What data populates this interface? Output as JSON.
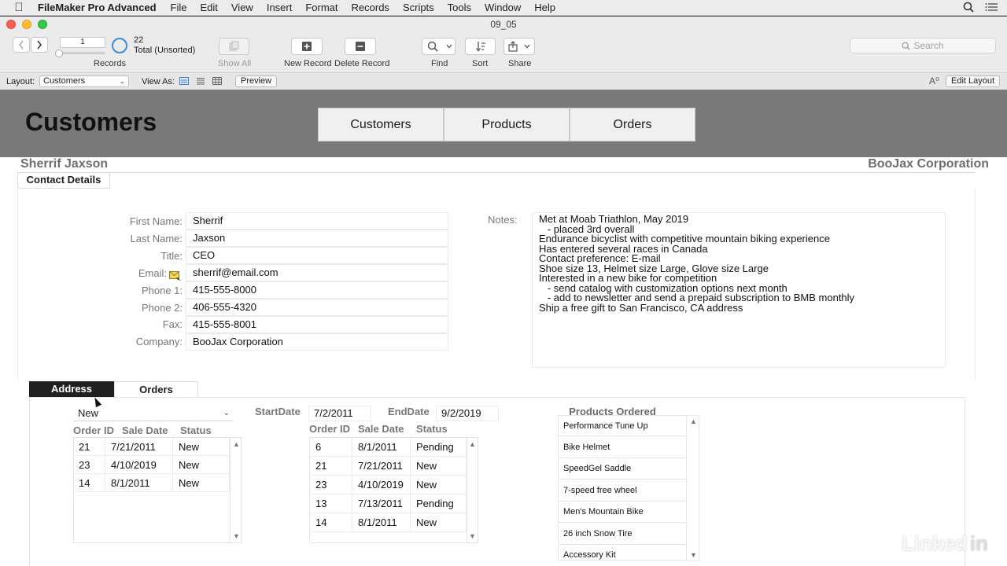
{
  "menubar": {
    "app_name": "FileMaker Pro Advanced",
    "items": [
      "File",
      "Edit",
      "View",
      "Insert",
      "Format",
      "Records",
      "Scripts",
      "Tools",
      "Window",
      "Help"
    ]
  },
  "window": {
    "title": "09_05"
  },
  "toolbar": {
    "record_number": "1",
    "total_count": "22",
    "total_status": "Total (Unsorted)",
    "records_label": "Records",
    "show_all_label": "Show All",
    "new_record_label": "New Record",
    "delete_record_label": "Delete Record",
    "find_label": "Find",
    "sort_label": "Sort",
    "share_label": "Share",
    "search_placeholder": "Search"
  },
  "layoutbar": {
    "layout_label": "Layout:",
    "layout_value": "Customers",
    "view_as_label": "View As:",
    "preview_label": "Preview",
    "edit_layout_label": "Edit Layout"
  },
  "header": {
    "title": "Customers",
    "nav": [
      "Customers",
      "Products",
      "Orders"
    ]
  },
  "record": {
    "display_name": "Sherrif Jaxson",
    "display_company": "BooJax Corporation",
    "tab_contact": "Contact Details",
    "fields": [
      {
        "label": "First Name:",
        "value": "Sherrif"
      },
      {
        "label": "Last Name:",
        "value": "Jaxson"
      },
      {
        "label": "Title:",
        "value": "CEO"
      },
      {
        "label": "Email:",
        "value": "sherrif@email.com"
      },
      {
        "label": "Phone 1:",
        "value": "415-555-8000"
      },
      {
        "label": "Phone 2:",
        "value": "406-555-4320"
      },
      {
        "label": "Fax:",
        "value": "415-555-8001"
      },
      {
        "label": "Company:",
        "value": "BooJax Corporation"
      }
    ],
    "notes_label": "Notes:",
    "notes": "Met at Moab Triathlon, May 2019\n   - placed 3rd overall\nEndurance bicyclist with competitive mountain biking experience\nHas entered several races in Canada\nContact preference: E-mail\nShoe size 13, Helmet size Large, Glove size Large\nInterested in a new bike for competition\n   - send catalog with customization options next month\n   - add to newsletter and send a prepaid subscription to BMB monthly\nShip a free gift to San Francisco, CA address"
  },
  "orders_section": {
    "tab_address": "Address",
    "tab_orders": "Orders",
    "status_filter": "New",
    "columns": [
      "Order ID",
      "Sale Date",
      "Status"
    ],
    "filtered_orders": [
      {
        "id": "21",
        "date": "7/21/2011",
        "status": "New"
      },
      {
        "id": "23",
        "date": "4/10/2019",
        "status": "New"
      },
      {
        "id": "14",
        "date": "8/1/2011",
        "status": "New"
      }
    ],
    "start_date_label": "StartDate",
    "start_date": "7/2/2011",
    "end_date_label": "EndDate",
    "end_date": "9/2/2019",
    "range_orders": [
      {
        "id": "6",
        "date": "8/1/2011",
        "status": "Pending"
      },
      {
        "id": "21",
        "date": "7/21/2011",
        "status": "New"
      },
      {
        "id": "23",
        "date": "4/10/2019",
        "status": "New"
      },
      {
        "id": "13",
        "date": "7/13/2011",
        "status": "Pending"
      },
      {
        "id": "14",
        "date": "8/1/2011",
        "status": "New"
      }
    ],
    "products_title": "Products Ordered",
    "products": [
      "Performance Tune Up",
      "Bike Helmet",
      "SpeedGel Saddle",
      "7-speed free wheel",
      "Men's Mountain Bike",
      "26 inch Snow Tire",
      "Accessory Kit"
    ]
  },
  "watermark": {
    "text": "Linked",
    "suffix": "in"
  },
  "colors": {
    "header_band": "#797979",
    "active_tab": "#202020",
    "accent_blue": "#3d8bdb"
  }
}
